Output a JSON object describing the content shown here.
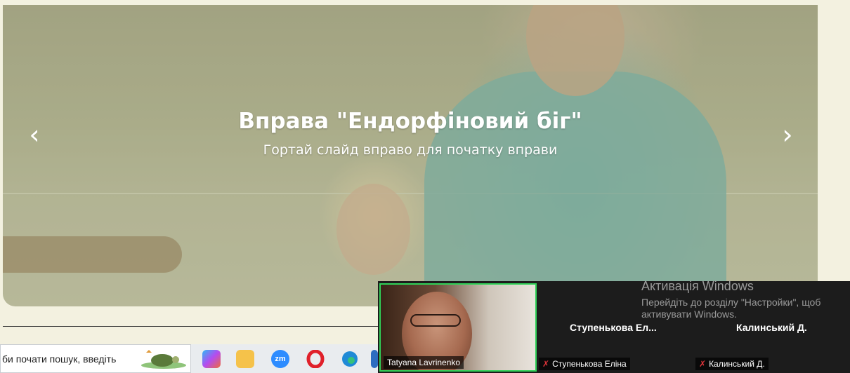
{
  "slider": {
    "title": "Вправа \"Ендорфіновий біг\"",
    "subtitle": "Гортай слайд вправо для початку вправи",
    "prev_arrow": "‹",
    "next_arrow": "›"
  },
  "taskbar": {
    "search_placeholder": "би почати пошук, введіть",
    "icons": [
      {
        "name": "copilot-icon",
        "label": ""
      },
      {
        "name": "file-explorer-icon",
        "label": ""
      },
      {
        "name": "zoom-app-icon",
        "label": "zm"
      },
      {
        "name": "opera-icon",
        "label": ""
      },
      {
        "name": "edge-icon",
        "label": ""
      }
    ]
  },
  "zoom": {
    "participants": [
      {
        "name": "Tatyana Lavrinenko",
        "tile_label": ""
      },
      {
        "name": "Ступенькова Еліна",
        "tile_label": "Ступенькова   Ел..."
      },
      {
        "name": "Калинський Д.",
        "tile_label": "Калинський Д."
      }
    ],
    "muted_icon": "mic-muted-icon"
  },
  "windows_activation": {
    "title": "Активація Windows",
    "message": "Перейдіть до розділу \"Настройки\", щоб активувати Windows."
  },
  "colors": {
    "page_bg": "#f3f1e0",
    "active_speaker_border": "#30d158",
    "zoom_bg": "#1c1c1c"
  }
}
